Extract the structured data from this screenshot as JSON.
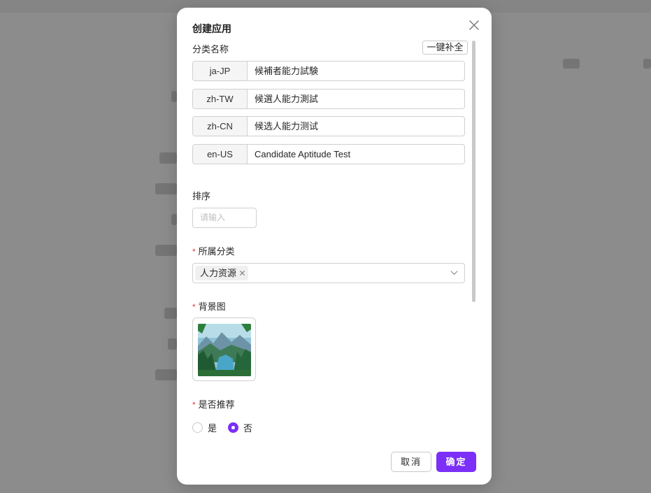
{
  "modal": {
    "title": "创建应用",
    "fill_button": "一键补全",
    "category_name_label": "分类名称",
    "languages": [
      {
        "code": "ja-JP",
        "value": "候補者能力試験"
      },
      {
        "code": "zh-TW",
        "value": "候選人能力測試"
      },
      {
        "code": "zh-CN",
        "value": "候选人能力测试"
      },
      {
        "code": "en-US",
        "value": "Candidate Aptitude Test"
      }
    ],
    "sort_label": "排序",
    "sort_placeholder": "请输入",
    "category_label": "所属分类",
    "category_tag": "人力资源",
    "background_label": "背景图",
    "recommend_label": "是否推荐",
    "recommend_options": {
      "yes": "是",
      "no": "否"
    },
    "recommend_selected": "否",
    "required_mark": "*",
    "cancel_label": "取消",
    "ok_label": "确定"
  },
  "colors": {
    "accent": "#7b2ff7",
    "required": "#e03a3a"
  }
}
